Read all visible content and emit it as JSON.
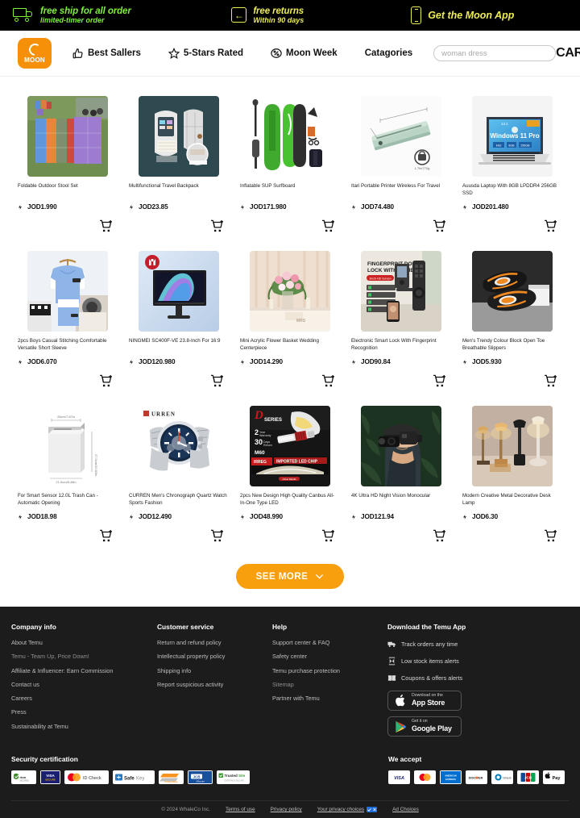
{
  "promo": {
    "items": [
      {
        "icon": "truck-icon",
        "line1": "free ship for all order",
        "line2": "limited-timer order",
        "color": "#7ef03a"
      },
      {
        "icon": "return-arrow-icon",
        "line1": "free returns",
        "line2": "Within 90 days",
        "color": "#ecec53"
      },
      {
        "icon": "phone-icon",
        "line1": "Get the Moon App",
        "line2": "",
        "color": "#ecec53"
      }
    ]
  },
  "nav": {
    "logo_word": "MOON",
    "links": [
      {
        "label": "Best Sallers",
        "icon": "thumbs-up-icon"
      },
      {
        "label": "5-Stars Rated",
        "icon": "star-icon"
      },
      {
        "label": "Moon Week",
        "icon": "percent-badge-icon"
      },
      {
        "label": "Catagories",
        "icon": ""
      }
    ],
    "search_placeholder": "woman dress",
    "search_value": "",
    "cart_label": "CART"
  },
  "products": [
    {
      "title": "Foldable Outdoor Stool Set",
      "price": "JOD1.990",
      "img": "stool-set"
    },
    {
      "title": "Multifunctional Travel Backpack",
      "price": "JOD23.85",
      "img": "backpack"
    },
    {
      "title": "Inflatable SUP Surfboard",
      "price": "JOD171.980",
      "img": "surfboard"
    },
    {
      "title": "Itari Portable Printer Wireless For Travel",
      "price": "JOD74.480",
      "img": "printer"
    },
    {
      "title": "Auusda Laptop With 8GB LPDDR4 256GB SSD",
      "price": "JOD201.480",
      "img": "laptop"
    },
    {
      "title": "2pcs Boys Casual Stitching Comfortable Versatile Short Sleeve",
      "price": "JOD6.070",
      "img": "boys-outfit"
    },
    {
      "title": "NINGMEI SC400F-VE 23.8-Inch For 16:9",
      "price": "JOD120.980",
      "img": "monitor"
    },
    {
      "title": "Mini Acrylic Flower Basket Wedding Centerpiece",
      "price": "JOD14.290",
      "img": "flower-basket"
    },
    {
      "title": "Electronic Smart Lock With Fingerprint Recognition",
      "price": "JOD90.84",
      "img": "smart-lock"
    },
    {
      "title": "Men's Trendy Colour Block Open Toe Breathable Slippers",
      "price": "JOD5.930",
      "img": "slippers"
    },
    {
      "title": "For Smart Sensor 12.0L Trash Can - Automatic Opening",
      "price": "JOD18.98",
      "img": "trash-can"
    },
    {
      "title": "CURREN Men's Chronograph Quartz Watch Sports Fashion",
      "price": "JOD12.490",
      "img": "watch"
    },
    {
      "title": "2pcs New Design High Quality Canbus All-In-One Type LED",
      "price": "JOD48.990",
      "img": "led-bulbs"
    },
    {
      "title": "4K Ultra HD Night Vision Monocular",
      "price": "JOD121.94",
      "img": "monocular"
    },
    {
      "title": "Modern Creative Metal Decorative Desk Lamp",
      "price": "JOD6.30",
      "img": "desk-lamp"
    }
  ],
  "see_more": {
    "label": "SEE MORE",
    "icon": "chevron-down-icon"
  },
  "footer": {
    "columns": [
      {
        "title": "Company info",
        "links": [
          "About Temu",
          "Temu - Team Up, Price Down!",
          "Affiliate & Influencer: Earn Commission",
          "Contact us",
          "Careers",
          "Press",
          "Sustainability at Temu"
        ]
      },
      {
        "title": "Customer service",
        "links": [
          "Return and refund policy",
          "Intellectual property policy",
          "Shipping info",
          "Report suspicious activity"
        ]
      },
      {
        "title": "Help",
        "links": [
          "Support center & FAQ",
          "Safety center",
          "Temu purchase protection",
          "Sitemap",
          "Partner with Temu"
        ]
      }
    ],
    "app": {
      "title": "Download the Temu App",
      "features": [
        {
          "label": "Track orders any time",
          "icon": "truck-icon"
        },
        {
          "label": "Low stock items alerts",
          "icon": "hourglass-icon"
        },
        {
          "label": "Coupons & offers alerts",
          "icon": "coupon-icon"
        }
      ],
      "badges": [
        {
          "icon": "apple-icon",
          "line1": "Download on the",
          "line2": "App Store"
        },
        {
          "icon": "google-play-icon",
          "line1": "Get it on",
          "line2": "Google Play"
        }
      ]
    },
    "security": {
      "title": "Security certification",
      "items": [
        "norton-secured",
        "visa-secure",
        "mastercard-id-check",
        "safekey",
        "protectbuy",
        "jcb-j-secure",
        "trustedsite"
      ]
    },
    "payments": {
      "title": "We accept",
      "items": [
        "visa",
        "mastercard",
        "amex",
        "discover",
        "diners-club",
        "jcb",
        "apple-pay"
      ]
    },
    "bottom": {
      "copyright": "© 2024 WhaleCo Inc.",
      "links": [
        "Terms of use",
        "Privacy policy",
        "Your privacy choices",
        "Ad Choices"
      ]
    }
  }
}
